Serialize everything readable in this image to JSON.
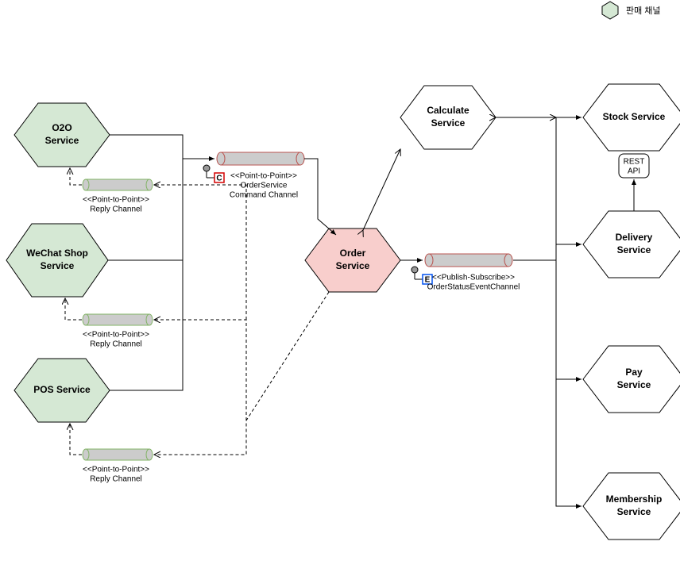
{
  "diagram": {
    "legend": {
      "label": "판매 채널"
    },
    "services": {
      "o2o": "O2O\nService",
      "wechat": "WeChat Shop\nService",
      "pos": "POS Service",
      "order": "Order\nService",
      "calculate": "Calculate\nService",
      "stock": "Stock Service",
      "delivery": "Delivery\nService",
      "pay": "Pay\nService",
      "membership": "Membership\nService"
    },
    "channels": {
      "command": {
        "stereotype": "<<Point-to-Point>>",
        "name": "OrderService\nCommand Channel",
        "badge": "C"
      },
      "event": {
        "stereotype": "<<Publish-Subscribe>>",
        "name": "OrderStatusEventChannel",
        "badge": "E"
      },
      "reply1": {
        "stereotype": "<<Point-to-Point>>",
        "name": "Reply Channel"
      },
      "reply2": {
        "stereotype": "<<Point-to-Point>>",
        "name": "Reply Channel"
      },
      "reply3": {
        "stereotype": "<<Point-to-Point>>",
        "name": "Reply Channel"
      }
    },
    "api": {
      "rest": "REST\nAPI"
    }
  }
}
